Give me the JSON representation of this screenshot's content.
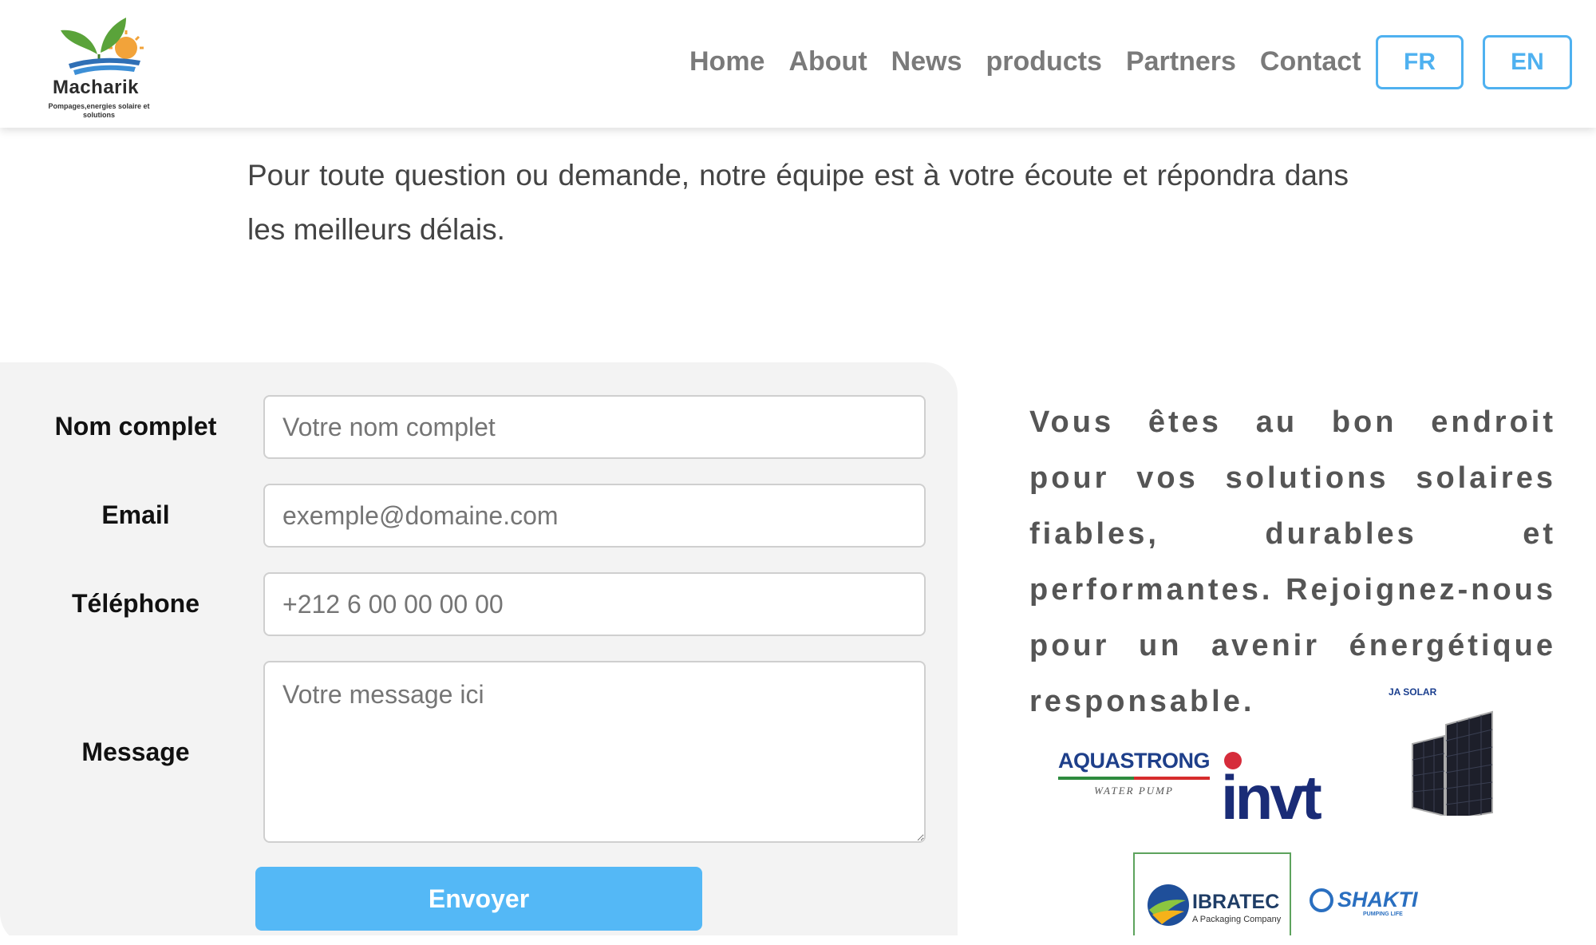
{
  "brand": {
    "name": "Macharik",
    "tagline": "Pompages,energies solaire et solutions"
  },
  "nav": {
    "items": [
      "Home",
      "About",
      "News",
      "products",
      "Partners",
      "Contact"
    ],
    "lang_fr": "FR",
    "lang_en": "EN"
  },
  "intro": {
    "text": "Pour toute question ou demande, notre équipe est à votre écoute et répondra dans les meilleurs délais."
  },
  "form": {
    "name_label": "Nom complet",
    "name_placeholder": "Votre nom complet",
    "email_label": "Email",
    "email_placeholder": "exemple@domaine.com",
    "phone_label": "Téléphone",
    "phone_placeholder": "+212 6 00 00 00 00",
    "message_label": "Message",
    "message_placeholder": "Votre message ici",
    "submit_label": "Envoyer"
  },
  "pitch": {
    "text": "Vous êtes au bon endroit pour vos solutions solaires fiables, durables et performantes. Rejoignez-nous pour un avenir énergétique responsable."
  },
  "partners": {
    "aquastrong": "AQUASTRONG",
    "aquastrong_sub": "WATER PUMP",
    "invt": "invt",
    "jasolar": "JA SOLAR",
    "ibratec": "IBRATEC",
    "ibratec_sub": "A Packaging Company",
    "shakti": "SHAKTI",
    "shakti_sub": "PUMPING LIFE"
  },
  "colors": {
    "accent": "#4fb1f0",
    "button": "#54b8f6",
    "panel": "#f3f3f3",
    "nav_text": "#7a7a7a"
  }
}
